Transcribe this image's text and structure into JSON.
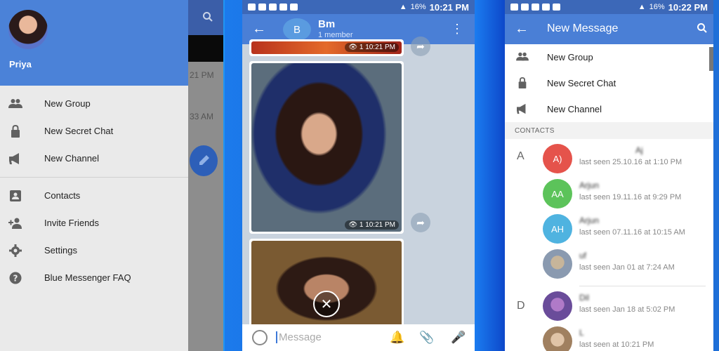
{
  "drawer": {
    "user_name": "Priya",
    "behind_times": [
      "21 PM",
      "33 AM"
    ],
    "items": [
      {
        "label": "New Group",
        "icon": "group-icon"
      },
      {
        "label": "New Secret Chat",
        "icon": "lock-icon"
      },
      {
        "label": "New Channel",
        "icon": "megaphone-icon"
      },
      {
        "label": "Contacts",
        "icon": "contacts-icon"
      },
      {
        "label": "Invite Friends",
        "icon": "person-add-icon"
      },
      {
        "label": "Settings",
        "icon": "gear-icon"
      },
      {
        "label": "Blue Messenger FAQ",
        "icon": "help-icon"
      }
    ]
  },
  "chat": {
    "status_time": "10:21 PM",
    "status_battery": "16%",
    "avatar_letter": "B",
    "title": "Bm",
    "subtitle": "1 member",
    "photos": [
      {
        "views": "1",
        "time": "10:21 PM"
      },
      {
        "views": "1",
        "time": "10:21 PM"
      }
    ],
    "compose_placeholder": "Message"
  },
  "new_message": {
    "status_time": "10:22 PM",
    "status_battery": "16%",
    "title": "New Message",
    "items": [
      {
        "label": "New Group",
        "icon": "group-icon"
      },
      {
        "label": "New Secret Chat",
        "icon": "lock-icon"
      },
      {
        "label": "New Channel",
        "icon": "megaphone-icon"
      }
    ],
    "contacts_header": "CONTACTS",
    "letters": [
      "A",
      "D"
    ],
    "contacts": [
      {
        "initials": "A)",
        "name": "Aj",
        "seen": "last seen 25.10.16 at 1:10 PM",
        "color": "#e5534b"
      },
      {
        "initials": "AA",
        "name": "Arjun",
        "seen": "last seen 19.11.16 at 9:29 PM",
        "color": "#5cc35a"
      },
      {
        "initials": "AH",
        "name": "Arjun",
        "seen": "last seen 07.11.16 at 10:15 AM",
        "color": "#4fb3e0"
      },
      {
        "initials": "",
        "name": "uf",
        "seen": "last seen Jan 01 at 7:24 AM",
        "color": "#8a9ab0"
      },
      {
        "initials": "",
        "name": "Dil",
        "seen": "last seen Jan 18 at 5:02 PM",
        "color": "#6a4c9a"
      },
      {
        "initials": "",
        "name": "L",
        "seen": "last seen at 10:21 PM",
        "color": "#a08060"
      }
    ]
  }
}
